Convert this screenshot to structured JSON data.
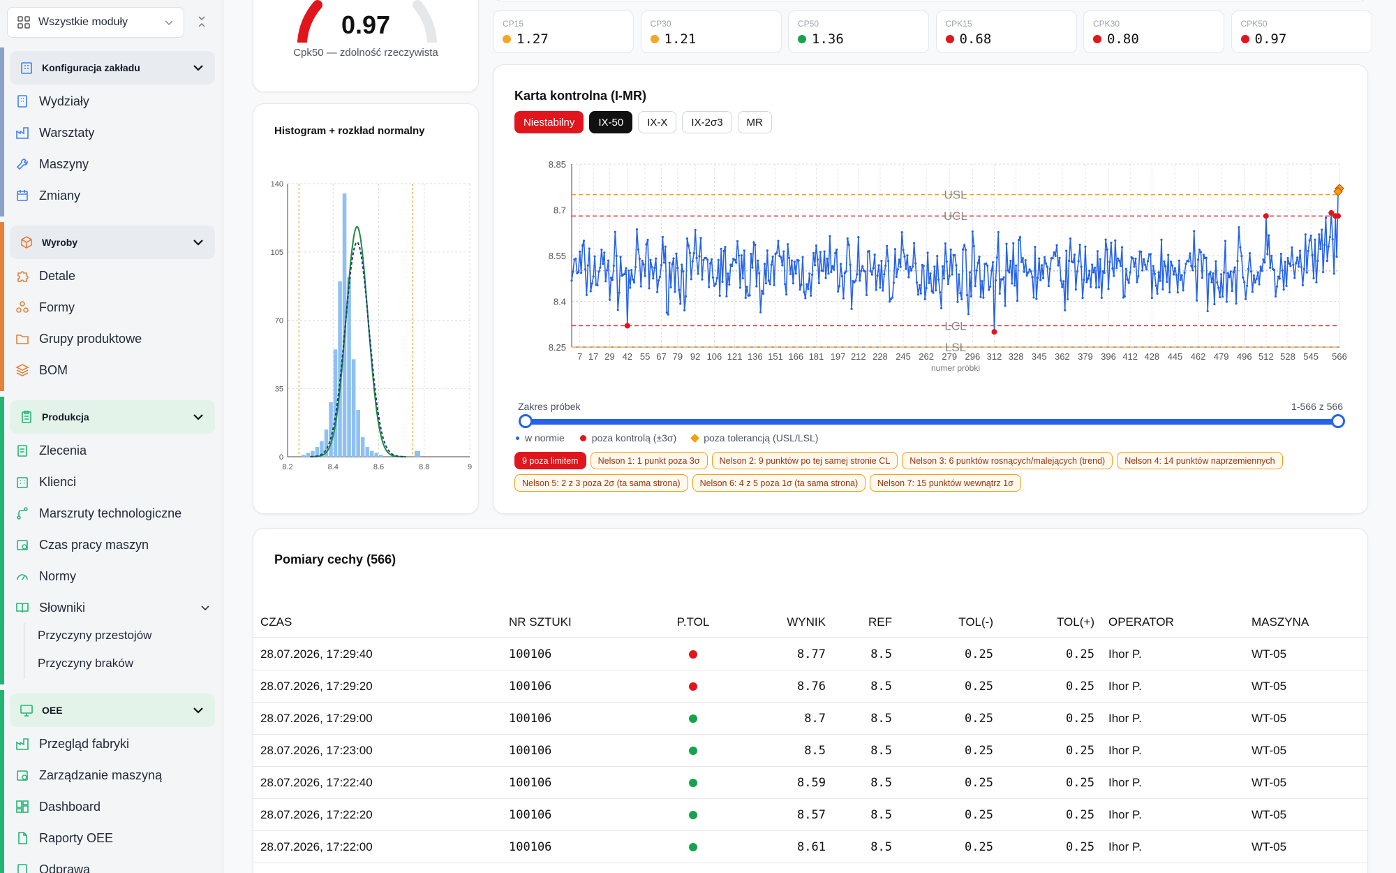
{
  "sidebar": {
    "module_select": "Wszystkie moduły",
    "groups": [
      {
        "title": "Konfiguracja zakładu",
        "color": "#8aa0c8",
        "items": [
          "Wydziały",
          "Warsztaty",
          "Maszyny",
          "Zmiany"
        ]
      },
      {
        "title": "Wyroby",
        "color": "#e4813b",
        "items": [
          "Detale",
          "Formy",
          "Grupy produktowe",
          "BOM"
        ]
      },
      {
        "title": "Produkcja",
        "color": "#22b573",
        "items": [
          "Zlecenia",
          "Klienci",
          "Marszruty technologiczne",
          "Czas pracy maszyn",
          "Normy",
          "Słowniki"
        ],
        "subitems": [
          "Przyczyny przestojów",
          "Przyczyny braków"
        ]
      },
      {
        "title": "OEE",
        "color": "#22b573",
        "items": [
          "Przegląd fabryki",
          "Zarządzanie maszyną",
          "Dashboard",
          "Raporty OEE",
          "Odprawa"
        ]
      }
    ]
  },
  "gauge": {
    "value": "0.97",
    "caption": "Cpk50 — zdolność rzeczywista",
    "color": "#e0161c"
  },
  "kpis": [
    {
      "label": "CP15",
      "value": "1.27",
      "color": "#f5a623"
    },
    {
      "label": "CP30",
      "value": "1.21",
      "color": "#f5a623"
    },
    {
      "label": "CP50",
      "value": "1.36",
      "color": "#16a34a"
    },
    {
      "label": "CPK15",
      "value": "0.68",
      "color": "#e0161c"
    },
    {
      "label": "CPK30",
      "value": "0.80",
      "color": "#e0161c"
    },
    {
      "label": "CPK50",
      "value": "0.97",
      "color": "#e0161c"
    }
  ],
  "histogram": {
    "title": "Histogram + rozkład normalny",
    "chart_data": {
      "type": "bar",
      "bin_width": 0.02,
      "x_start": 8.26,
      "values": [
        1,
        2,
        3,
        5,
        8,
        14,
        28,
        55,
        90,
        135,
        92,
        50,
        24,
        10,
        5,
        3,
        2,
        1
      ],
      "xlim": [
        8.2,
        9
      ],
      "ylim": [
        0,
        140
      ],
      "xticks": [
        8.2,
        8.4,
        8.6,
        8.8,
        9
      ],
      "yticks": [
        0,
        35,
        70,
        105,
        140
      ],
      "spec_lines": [
        8.25,
        8.75
      ],
      "extra_bar": {
        "x": 8.77,
        "value": 3
      }
    }
  },
  "control_chart": {
    "title": "Karta kontrolna (I-MR)",
    "tabs": [
      "Niestabilny",
      "IX-50",
      "IX-X",
      "IX-2σ3",
      "MR"
    ],
    "xlabel": "numer próbki",
    "limit_labels": {
      "usl": "USL",
      "ucl": "UCL",
      "lcl": "LCL",
      "lsl": "LSL"
    },
    "range_label": "Zakres próbek",
    "range_value": "1-566  z  566",
    "legend": [
      "w normie",
      "poza kontrolą (±3σ)",
      "poza tolerancją (USL/LSL)"
    ],
    "chart_data": {
      "type": "line",
      "n": 566,
      "ylim": [
        8.25,
        8.85
      ],
      "yticks": [
        8.25,
        8.4,
        8.55,
        8.7,
        8.85
      ],
      "xticks": [
        7,
        17,
        29,
        42,
        55,
        67,
        79,
        92,
        106,
        121,
        136,
        151,
        166,
        181,
        197,
        212,
        228,
        245,
        262,
        279,
        296,
        312,
        328,
        345,
        362,
        379,
        396,
        412,
        428,
        445,
        462,
        479,
        496,
        512,
        528,
        545,
        566
      ],
      "usl": 8.75,
      "ucl": 8.68,
      "lcl": 8.32,
      "lsl": 8.25,
      "mean": 8.5,
      "out_of_control": [
        {
          "x": 42,
          "y": 8.32
        },
        {
          "x": 312,
          "y": 8.3
        },
        {
          "x": 512,
          "y": 8.68
        },
        {
          "x": 560,
          "y": 8.69
        },
        {
          "x": 563,
          "y": 8.68
        },
        {
          "x": 565,
          "y": 8.68
        }
      ],
      "out_of_tolerance": [
        {
          "x": 566,
          "y": 8.77
        },
        {
          "x": 565,
          "y": 8.76
        }
      ]
    },
    "badges": [
      {
        "text": "9 poza limitem",
        "kind": "red"
      },
      {
        "text": "Nelson 1: 1 punkt poza 3σ",
        "kind": "warn"
      },
      {
        "text": "Nelson 2: 9 punktów po tej samej stronie CL",
        "kind": "warn"
      },
      {
        "text": "Nelson 3: 6 punktów rosnących/malejących (trend)",
        "kind": "warn"
      },
      {
        "text": "Nelson 4: 14 punktów naprzemiennych",
        "kind": "warn"
      },
      {
        "text": "Nelson 5: 2 z 3 poza 2σ (ta sama strona)",
        "kind": "warn"
      },
      {
        "text": "Nelson 6: 4 z 5 poza 1σ (ta sama strona)",
        "kind": "warn"
      },
      {
        "text": "Nelson 7: 15 punktów wewnątrz 1σ",
        "kind": "warn"
      }
    ]
  },
  "table": {
    "title": "Pomiary cechy (566)",
    "columns": [
      "CZAS",
      "NR SZTUKI",
      "P.TOL",
      "WYNIK",
      "REF",
      "TOL(-)",
      "TOL(+)",
      "OPERATOR",
      "MASZYNA"
    ],
    "rows": [
      {
        "time": "28.07.2026, 17:29:40",
        "nr": "100106",
        "ok": false,
        "wynik": "8.77",
        "ref": "8.5",
        "tolm": "0.25",
        "tolp": "0.25",
        "op": "Ihor P.",
        "m": "WT-05"
      },
      {
        "time": "28.07.2026, 17:29:20",
        "nr": "100106",
        "ok": false,
        "wynik": "8.76",
        "ref": "8.5",
        "tolm": "0.25",
        "tolp": "0.25",
        "op": "Ihor P.",
        "m": "WT-05"
      },
      {
        "time": "28.07.2026, 17:29:00",
        "nr": "100106",
        "ok": true,
        "wynik": "8.7",
        "ref": "8.5",
        "tolm": "0.25",
        "tolp": "0.25",
        "op": "Ihor P.",
        "m": "WT-05"
      },
      {
        "time": "28.07.2026, 17:23:00",
        "nr": "100106",
        "ok": true,
        "wynik": "8.5",
        "ref": "8.5",
        "tolm": "0.25",
        "tolp": "0.25",
        "op": "Ihor P.",
        "m": "WT-05"
      },
      {
        "time": "28.07.2026, 17:22:40",
        "nr": "100106",
        "ok": true,
        "wynik": "8.59",
        "ref": "8.5",
        "tolm": "0.25",
        "tolp": "0.25",
        "op": "Ihor P.",
        "m": "WT-05"
      },
      {
        "time": "28.07.2026, 17:22:20",
        "nr": "100106",
        "ok": true,
        "wynik": "8.57",
        "ref": "8.5",
        "tolm": "0.25",
        "tolp": "0.25",
        "op": "Ihor P.",
        "m": "WT-05"
      },
      {
        "time": "28.07.2026, 17:22:00",
        "nr": "100106",
        "ok": true,
        "wynik": "8.61",
        "ref": "8.5",
        "tolm": "0.25",
        "tolp": "0.25",
        "op": "Ihor P.",
        "m": "WT-05"
      }
    ]
  }
}
